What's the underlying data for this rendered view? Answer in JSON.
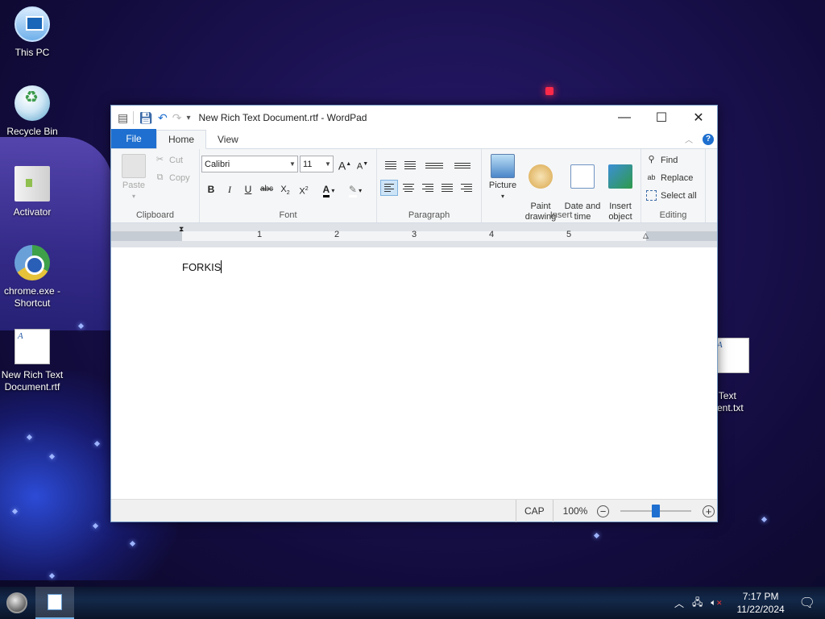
{
  "desktop": {
    "icons": [
      {
        "label": "This PC"
      },
      {
        "label": "Recycle Bin"
      },
      {
        "label": "Activator"
      },
      {
        "label": "chrome.exe - Shortcut"
      },
      {
        "label": "New Rich Text Document.rtf"
      },
      {
        "label": "w Text\nment.txt"
      }
    ]
  },
  "window": {
    "title": "New Rich Text Document.rtf - WordPad",
    "tabs": {
      "file": "File",
      "home": "Home",
      "view": "View"
    },
    "ribbon": {
      "clipboard": {
        "label": "Clipboard",
        "paste": "Paste",
        "cut": "Cut",
        "copy": "Copy"
      },
      "font": {
        "label": "Font",
        "family": "Calibri",
        "size": "11"
      },
      "paragraph": {
        "label": "Paragraph"
      },
      "insert": {
        "label": "Insert",
        "picture": "Picture",
        "paint": "Paint\ndrawing",
        "datetime": "Date and\ntime",
        "object": "Insert\nobject"
      },
      "editing": {
        "label": "Editing",
        "find": "Find",
        "replace": "Replace",
        "select_all": "Select all"
      }
    },
    "ruler": {
      "numbers": [
        "1",
        "2",
        "3",
        "4",
        "5"
      ]
    },
    "document": {
      "text": "FORKIS"
    },
    "status": {
      "caps": "CAP",
      "zoom": "100%",
      "zoom_level": 100
    }
  },
  "taskbar": {
    "time": "7:17 PM",
    "date": "11/22/2024"
  }
}
